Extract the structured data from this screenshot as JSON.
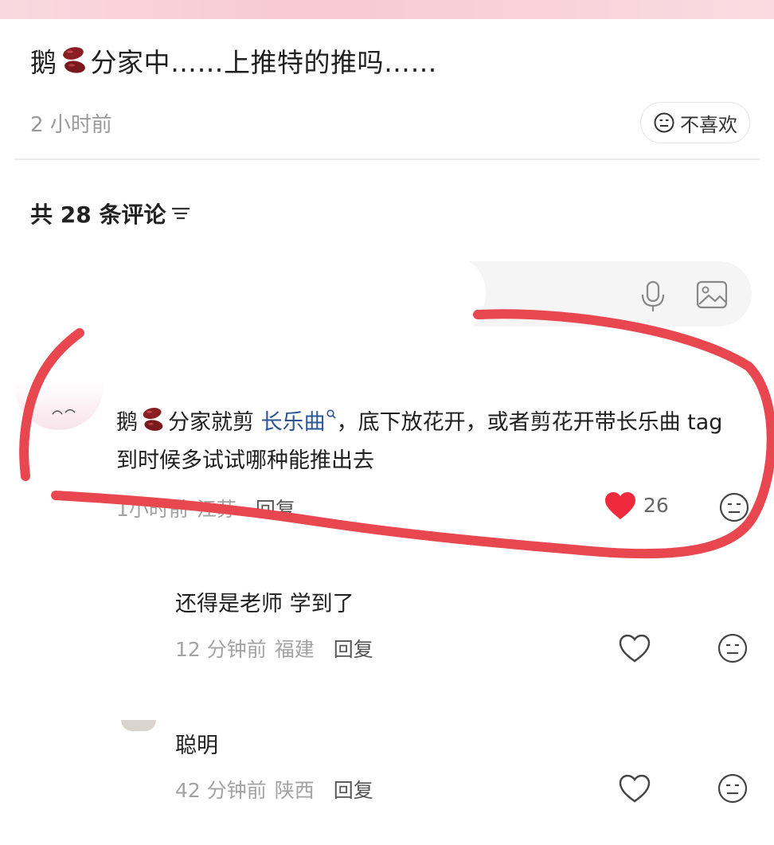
{
  "post": {
    "title_prefix": "鹅",
    "title_suffix": "分家中……上推特的推吗……",
    "time": "2 小时前",
    "dislike_label": "不喜欢"
  },
  "comments_header": {
    "label": "共 28 条评论"
  },
  "comments": [
    {
      "text_prefix": "鹅",
      "text_mid": "分家就剪 ",
      "link": "长乐曲",
      "text_rest": "，底下放花开，或者剪花开带长乐曲 tag 到时候多试试哪种能推出去",
      "time": "1小时前",
      "location": "江苏",
      "reply": "回复",
      "likes": "26",
      "liked": true
    },
    {
      "text": "还得是老师 学到了",
      "time": "12 分钟前",
      "location": "福建",
      "reply": "回复",
      "liked": false
    },
    {
      "text": "聪明",
      "time": "42 分钟前",
      "location": "陕西",
      "reply": "回复",
      "liked": false
    }
  ],
  "colors": {
    "annotation_red": "#e8474f",
    "like_red": "#ee2a3c",
    "link_blue": "#2b5797"
  },
  "icons": [
    "dislike-face-icon",
    "filter-icon",
    "microphone-icon",
    "image-icon",
    "bean-emoji-icon",
    "heart-icon",
    "face-icon",
    "search-mini-icon"
  ]
}
